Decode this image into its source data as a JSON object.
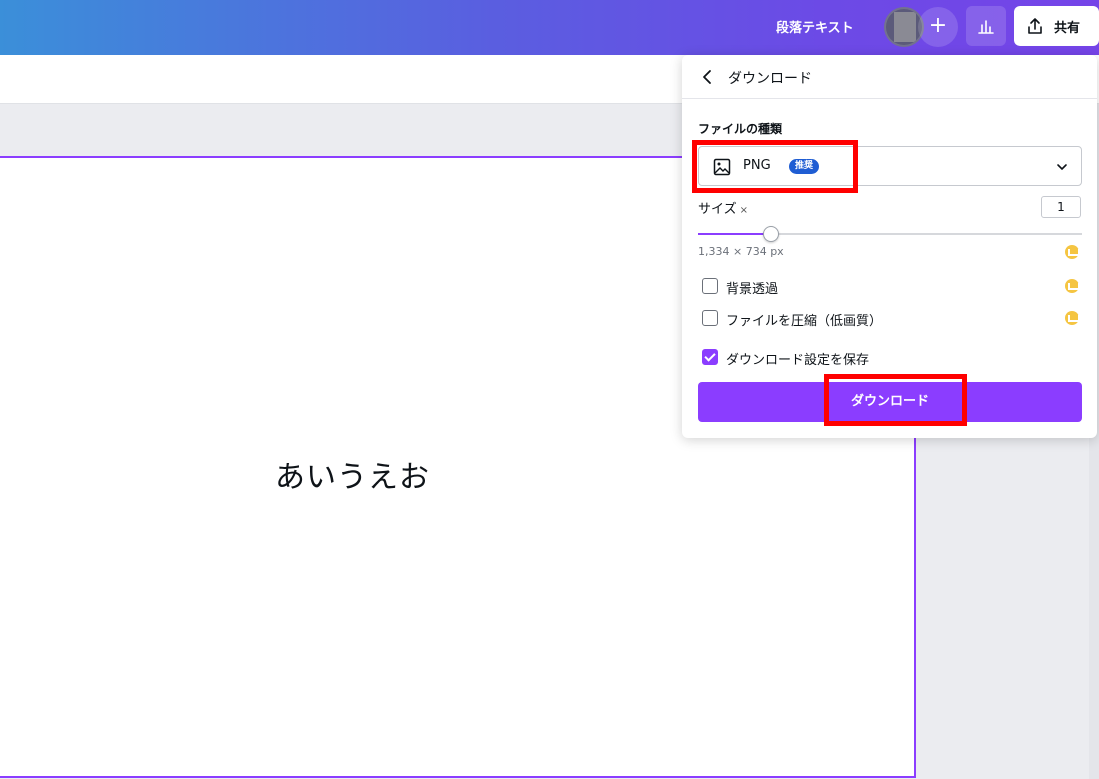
{
  "header": {
    "doc_title": "段落テキスト",
    "plus_symbol": "+",
    "share_label": "共有",
    "gradient_start": "#3b8fd9",
    "gradient_end": "#7544e8"
  },
  "canvas": {
    "text": "あいうえお",
    "border_color": "#8b3dff"
  },
  "download_panel": {
    "title": "ダウンロード",
    "file_type_label": "ファイルの種類",
    "file_type_value": "PNG",
    "recommended_badge": "推奨",
    "size_label": "サイズ",
    "size_mark": "×",
    "size_value": "1",
    "slider_fraction": 0.19,
    "dimensions": "1,334 × 734 px",
    "options": [
      {
        "label": "背景透過",
        "checked": false,
        "premium": true
      },
      {
        "label": "ファイルを圧縮（低画質）",
        "checked": false,
        "premium": true
      },
      {
        "label": "ダウンロード設定を保存",
        "checked": true,
        "premium": false
      }
    ],
    "download_button": "ダウンロード",
    "accent_color": "#8b3dff",
    "badge_color": "#1f5dd3",
    "premium_color": "#f5c542"
  }
}
